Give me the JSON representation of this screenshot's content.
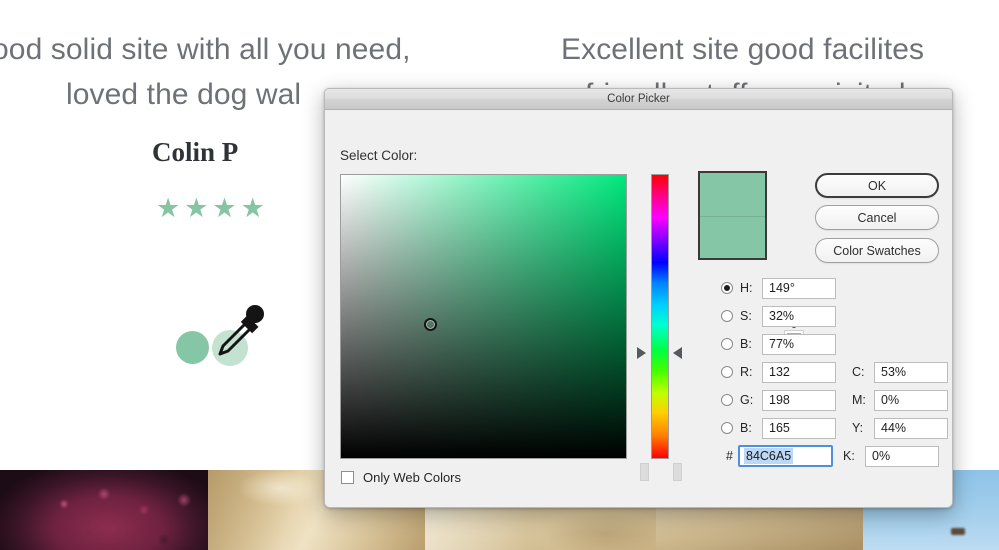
{
  "background": {
    "reviews": [
      {
        "id": "rev-left-1",
        "text": "ood solid site with all you need,"
      },
      {
        "id": "rev-left-2",
        "text": "loved the dog wal"
      },
      {
        "id": "rev-right-1",
        "text": "Excellent site good facilites"
      },
      {
        "id": "rev-right-2",
        "text": "friendly staff , we visited a"
      }
    ],
    "reviewer_name": "Colin P",
    "stars": "★★★★",
    "star_count": 4,
    "star_color": "#86c4a2",
    "swatch_dot_solid": "#84c6a5",
    "swatch_dot_light": "#c3e2d0",
    "eyedropper_icon": "eyedropper-icon"
  },
  "dialog": {
    "title": "Color Picker",
    "select_label": "Select Color:",
    "buttons": {
      "ok": "OK",
      "cancel": "Cancel",
      "color_swatches": "Color Swatches"
    },
    "preview_color": "#84c6a5",
    "gamut_swatch_color": "#93c47d",
    "gamut_icon": "cube-icon",
    "fields": {
      "h": {
        "label": "H:",
        "value": "149°",
        "selected": true
      },
      "s": {
        "label": "S:",
        "value": "32%",
        "selected": false
      },
      "b": {
        "label": "B:",
        "value": "77%",
        "selected": false
      },
      "r": {
        "label": "R:",
        "value": "132",
        "selected": false
      },
      "g": {
        "label": "G:",
        "value": "198",
        "selected": false
      },
      "bb": {
        "label": "B:",
        "value": "165",
        "selected": false
      },
      "c": {
        "label": "C:",
        "value": "53%"
      },
      "m": {
        "label": "M:",
        "value": "0%"
      },
      "y": {
        "label": "Y:",
        "value": "44%"
      },
      "k": {
        "label": "K:",
        "value": "0%"
      }
    },
    "hex": {
      "prefix": "#",
      "value": "84C6A5"
    },
    "only_web_colors": {
      "label": "Only Web Colors",
      "checked": false
    }
  }
}
